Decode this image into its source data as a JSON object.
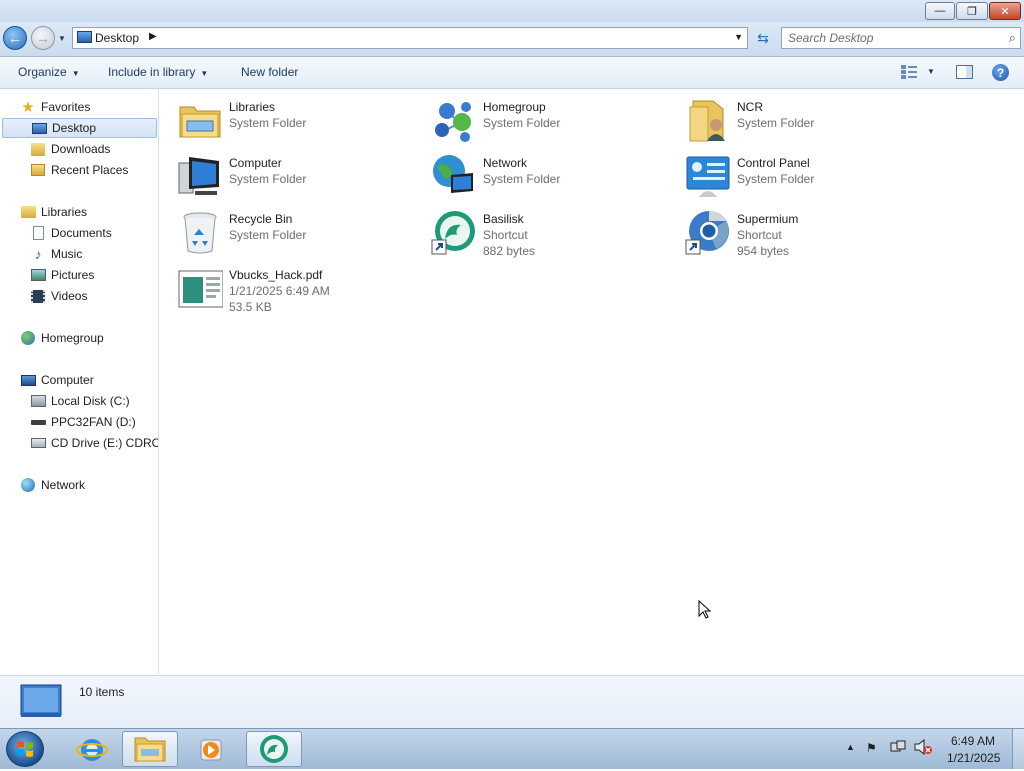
{
  "window": {
    "controls": {
      "minimize": "—",
      "maximize": "❐",
      "close": "✕"
    }
  },
  "address": {
    "location": "Desktop",
    "search_placeholder": "Search Desktop"
  },
  "toolbar": {
    "organize": "Organize",
    "include_in_library": "Include in library",
    "new_folder": "New folder"
  },
  "navpane": {
    "favorites": {
      "label": "Favorites",
      "items": [
        "Desktop",
        "Downloads",
        "Recent Places"
      ]
    },
    "libraries": {
      "label": "Libraries",
      "items": [
        "Documents",
        "Music",
        "Pictures",
        "Videos"
      ]
    },
    "homegroup": "Homegroup",
    "computer": {
      "label": "Computer",
      "items": [
        "Local Disk (C:)",
        "PPC32FAN (D:)",
        "CD Drive (E:) CDROM"
      ]
    },
    "network": "Network"
  },
  "files": [
    {
      "name": "Libraries",
      "line2": "System Folder",
      "line3": "",
      "icon": "libraries-icon"
    },
    {
      "name": "Homegroup",
      "line2": "System Folder",
      "line3": "",
      "icon": "homegroup-icon"
    },
    {
      "name": "NCR",
      "line2": "System Folder",
      "line3": "",
      "icon": "user-folder-icon"
    },
    {
      "name": "Computer",
      "line2": "System Folder",
      "line3": "",
      "icon": "computer-icon"
    },
    {
      "name": "Network",
      "line2": "System Folder",
      "line3": "",
      "icon": "network-icon"
    },
    {
      "name": "Control Panel",
      "line2": "System Folder",
      "line3": "",
      "icon": "control-panel-icon"
    },
    {
      "name": "Recycle Bin",
      "line2": "System Folder",
      "line3": "",
      "icon": "recycle-bin-icon"
    },
    {
      "name": "Basilisk",
      "line2": "Shortcut",
      "line3": "882 bytes",
      "icon": "basilisk-icon"
    },
    {
      "name": "Supermium",
      "line2": "Shortcut",
      "line3": "954 bytes",
      "icon": "supermium-icon"
    },
    {
      "name": "Vbucks_Hack.pdf",
      "line2": "1/21/2025 6:49 AM",
      "line3": "53.5 KB",
      "icon": "pdf-document-icon"
    }
  ],
  "details": {
    "count": "10 items"
  },
  "taskbar": {
    "time": "6:49 AM",
    "date": "1/21/2025",
    "tray_arrow": "▲"
  }
}
